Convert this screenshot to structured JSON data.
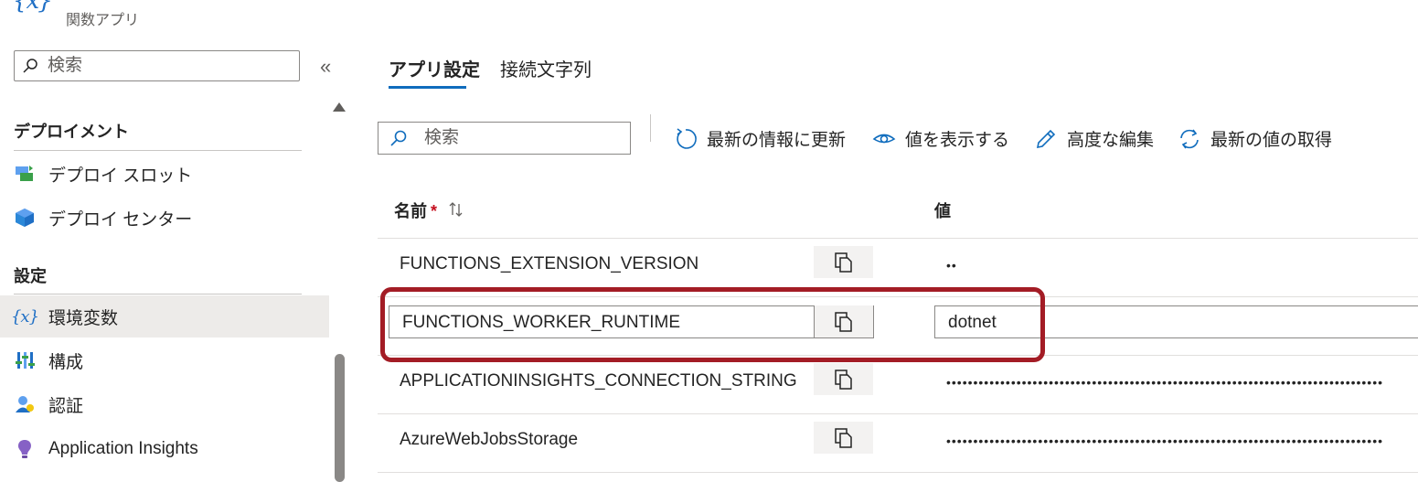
{
  "header": {
    "app_icon_text": "{𝑥}",
    "app_type": "関数アプリ"
  },
  "sidebar": {
    "search_placeholder": "検索",
    "collapse_glyph": "«",
    "groups": [
      {
        "heading": "デプロイメント",
        "items": [
          {
            "label": "デプロイ スロット",
            "icon": "deployment-slots-icon"
          },
          {
            "label": "デプロイ センター",
            "icon": "deployment-center-icon"
          }
        ]
      },
      {
        "heading": "設定",
        "items": [
          {
            "label": "環境変数",
            "icon": "environment-variables-icon",
            "selected": true
          },
          {
            "label": "構成",
            "icon": "configuration-icon"
          },
          {
            "label": "認証",
            "icon": "authentication-icon"
          },
          {
            "label": "Application Insights",
            "icon": "application-insights-icon"
          }
        ]
      }
    ]
  },
  "tabs": [
    {
      "label": "アプリ設定",
      "active": true
    },
    {
      "label": "接続文字列",
      "active": false
    }
  ],
  "toolbar": {
    "search_placeholder": "検索",
    "refresh": "最新の情報に更新",
    "show_values": "値を表示する",
    "advanced_edit": "高度な編集",
    "pull_latest": "最新の値の取得"
  },
  "table": {
    "col_name": "名前",
    "required_mark": "*",
    "col_value": "値",
    "rows": [
      {
        "name": "FUNCTIONS_EXTENSION_VERSION",
        "value": "••"
      },
      {
        "name": "FUNCTIONS_WORKER_RUNTIME",
        "value": "dotnet",
        "editing": true
      },
      {
        "name": "APPLICATIONINSIGHTS_CONNECTION_STRING",
        "value": "•••••••••••••••••••••••••••••••••••••••••••••••••••••••••••••••••••••••••••••••••"
      },
      {
        "name": "AzureWebJobsStorage",
        "value": "•••••••••••••••••••••••••••••••••••••••••••••••••••••••••••••••••••••••••••••••••"
      }
    ]
  },
  "colors": {
    "accent": "#0f6cbd",
    "highlight_border": "#a31c25",
    "selected_bg": "#edebe9",
    "required": "#c50f1f"
  }
}
